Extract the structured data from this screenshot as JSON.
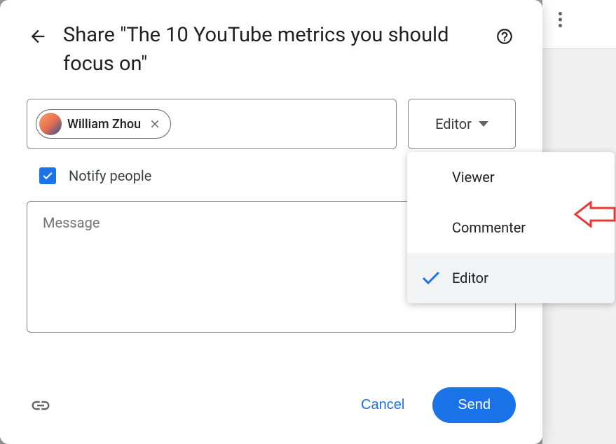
{
  "dialog": {
    "title": "Share \"The 10 YouTube metrics you should focus on\"",
    "person": {
      "name": "William Zhou"
    },
    "role_selected": "Editor",
    "notify_label": "Notify people",
    "message_placeholder": "Message",
    "cancel_label": "Cancel",
    "send_label": "Send"
  },
  "dropdown": {
    "items": [
      {
        "label": "Viewer",
        "selected": false
      },
      {
        "label": "Commenter",
        "selected": false
      },
      {
        "label": "Editor",
        "selected": true
      }
    ]
  }
}
